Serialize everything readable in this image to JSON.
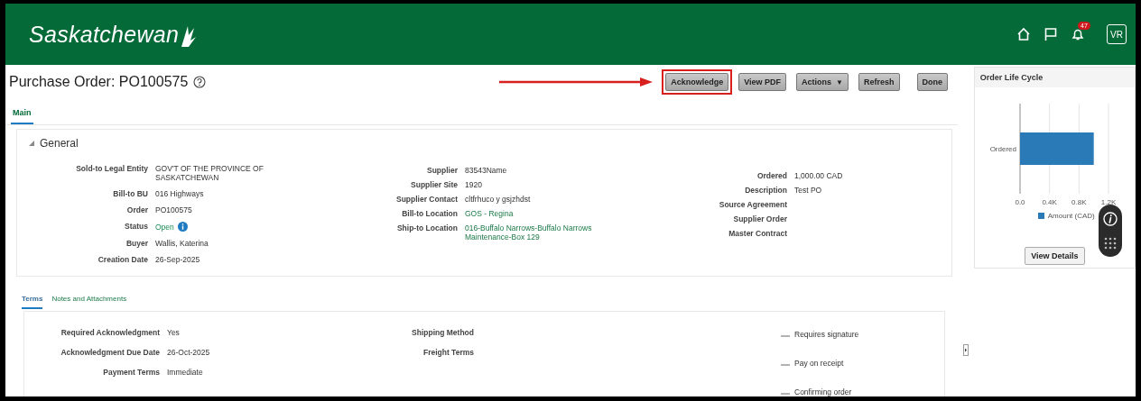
{
  "header": {
    "logo": "Saskatchewan",
    "notification_count": "47",
    "user_initials": "VR"
  },
  "page": {
    "title": "Purchase Order: PO100575"
  },
  "toolbar": {
    "buttons": [
      {
        "label": "Acknowledge",
        "highlighted": true,
        "kind": "plain"
      },
      {
        "label": "View PDF",
        "highlighted": false,
        "kind": "plain"
      },
      {
        "label": "Actions",
        "highlighted": false,
        "kind": "menu",
        "caret": "▼"
      },
      {
        "label": "Refresh",
        "highlighted": false,
        "kind": "plain"
      },
      {
        "label": "Done",
        "highlighted": false,
        "kind": "plain"
      }
    ]
  },
  "tabs": [
    {
      "label": "Main",
      "selected": true
    }
  ],
  "general": {
    "title": "General",
    "expanded": true,
    "columns": [
      [
        {
          "label": "Sold-to Legal Entity",
          "value": "GOV'T OF THE PROVINCE OF SASKATCHEWAN",
          "kind": "text"
        },
        {
          "label": "Bill-to BU",
          "value": "016 Highways",
          "kind": "text"
        },
        {
          "label": "Order",
          "value": "PO100575",
          "kind": "text"
        },
        {
          "label": "Status",
          "value": "Open",
          "kind": "status"
        },
        {
          "label": "Buyer",
          "value": "Wallis, Katerina",
          "kind": "text"
        },
        {
          "label": "Creation Date",
          "value": "26-Sep-2025",
          "kind": "text"
        }
      ],
      [
        {
          "label": "Supplier",
          "value": "83543Name",
          "kind": "text"
        },
        {
          "label": "Supplier Site",
          "value": "1920",
          "kind": "text"
        },
        {
          "label": "Supplier Contact",
          "value": "cltfrhuco y gsjzhdst",
          "kind": "text"
        },
        {
          "label": "Bill-to Location",
          "value": "GOS - Regina",
          "kind": "link"
        },
        {
          "label": "Ship-to Location",
          "value": "016-Buffalo Narrows-Buffalo Narrows Maintenance-Box 129",
          "kind": "link"
        }
      ],
      [
        {
          "label": "Ordered",
          "value": "1,000.00 CAD",
          "kind": "text"
        },
        {
          "label": "Description",
          "value": "Test PO",
          "kind": "text"
        },
        {
          "label": "Source Agreement"
        },
        {
          "label": "Supplier Order"
        },
        {
          "label": "Master Contract"
        }
      ]
    ]
  },
  "sub_tabs": [
    {
      "label": "Terms",
      "selected": true
    },
    {
      "label": "Notes and Attachments",
      "selected": false
    }
  ],
  "terms": {
    "left": [
      {
        "label": "Required Acknowledgment",
        "value": "Yes"
      },
      {
        "label": "Acknowledgment Due Date",
        "value": "26-Oct-2025"
      },
      {
        "label": "Payment Terms",
        "value": "Immediate"
      }
    ],
    "middle": [
      {
        "label": "Shipping Method"
      },
      {
        "label": "Freight Terms"
      }
    ],
    "flags": [
      {
        "label": "Requires signature",
        "checked": false
      },
      {
        "label": "Pay on receipt",
        "checked": false
      },
      {
        "label": "Confirming order",
        "checked": false
      }
    ]
  },
  "side_panel": {
    "title": "Order Life Cycle",
    "button": "View Details",
    "chart_data": {
      "type": "bar",
      "orientation": "horizontal",
      "categories": [
        "Ordered"
      ],
      "series": [
        {
          "name": "Amount (CAD)",
          "color": "#2a7ab8",
          "values": [
            1000
          ]
        }
      ],
      "xlim": [
        0,
        1200
      ],
      "xticks": [
        {
          "value": 0,
          "label": "0.0"
        },
        {
          "value": 400,
          "label": "0.4K"
        },
        {
          "value": 800,
          "label": "0.8K"
        },
        {
          "value": 1200,
          "label": "1.2K"
        }
      ]
    }
  }
}
